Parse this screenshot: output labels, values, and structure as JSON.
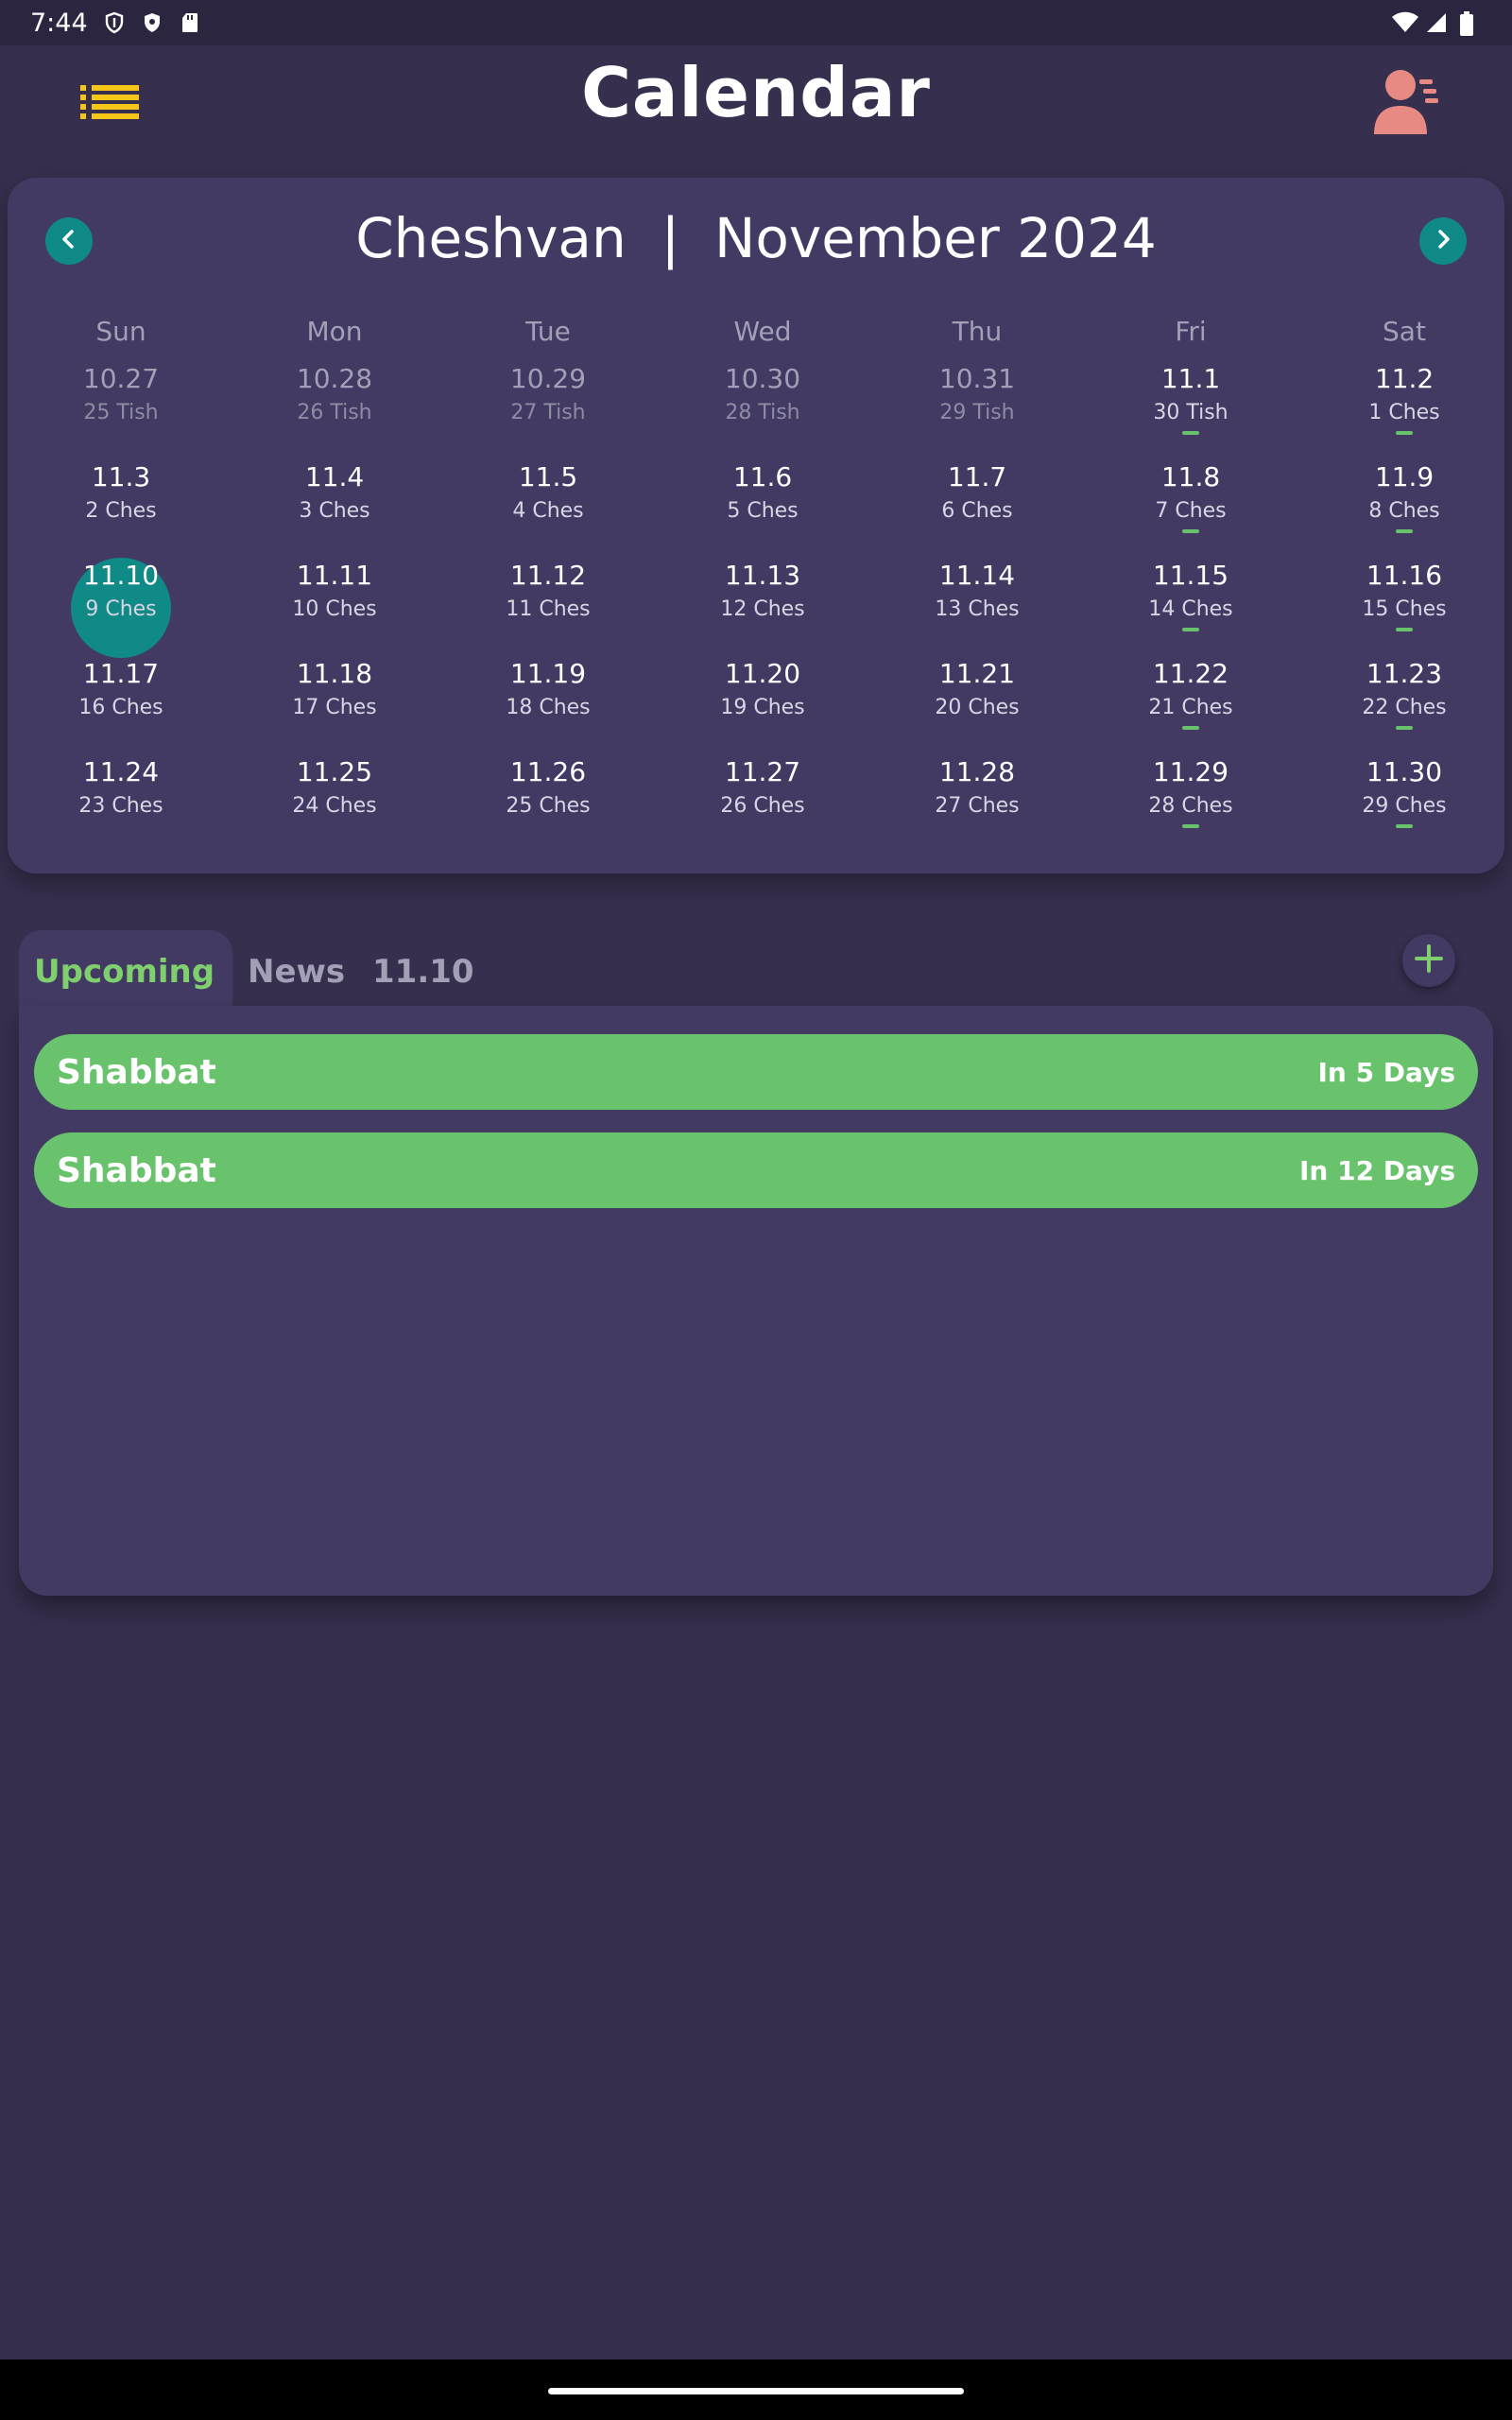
{
  "status_bar": {
    "time": "7:44",
    "left_icons": [
      "shield-icon",
      "shield-dot-icon",
      "sd-card-icon"
    ],
    "right_icons": [
      "wifi-icon",
      "signal-icon",
      "battery-icon"
    ]
  },
  "header": {
    "title": "Calendar",
    "menu_icon": "list-icon",
    "profile_icon": "user-profile-icon",
    "colors": {
      "menu": "#f5c518",
      "profile": "#e88a84"
    }
  },
  "calendar": {
    "title": "Cheshvan  |  November 2024",
    "prev_icon": "chevron-left-icon",
    "next_icon": "chevron-right-icon",
    "weekdays": [
      "Sun",
      "Mon",
      "Tue",
      "Wed",
      "Thu",
      "Fri",
      "Sat"
    ],
    "weeks": [
      [
        {
          "greg": "10.27",
          "heb": "25 Tish",
          "muted": true,
          "event": false,
          "selected": false
        },
        {
          "greg": "10.28",
          "heb": "26 Tish",
          "muted": true,
          "event": false,
          "selected": false
        },
        {
          "greg": "10.29",
          "heb": "27 Tish",
          "muted": true,
          "event": false,
          "selected": false
        },
        {
          "greg": "10.30",
          "heb": "28 Tish",
          "muted": true,
          "event": false,
          "selected": false
        },
        {
          "greg": "10.31",
          "heb": "29 Tish",
          "muted": true,
          "event": false,
          "selected": false
        },
        {
          "greg": "11.1",
          "heb": "30 Tish",
          "muted": false,
          "event": true,
          "selected": false
        },
        {
          "greg": "11.2",
          "heb": "1 Ches",
          "muted": false,
          "event": true,
          "selected": false
        }
      ],
      [
        {
          "greg": "11.3",
          "heb": "2 Ches",
          "muted": false,
          "event": false,
          "selected": false
        },
        {
          "greg": "11.4",
          "heb": "3 Ches",
          "muted": false,
          "event": false,
          "selected": false
        },
        {
          "greg": "11.5",
          "heb": "4 Ches",
          "muted": false,
          "event": false,
          "selected": false
        },
        {
          "greg": "11.6",
          "heb": "5 Ches",
          "muted": false,
          "event": false,
          "selected": false
        },
        {
          "greg": "11.7",
          "heb": "6 Ches",
          "muted": false,
          "event": false,
          "selected": false
        },
        {
          "greg": "11.8",
          "heb": "7 Ches",
          "muted": false,
          "event": true,
          "selected": false
        },
        {
          "greg": "11.9",
          "heb": "8 Ches",
          "muted": false,
          "event": true,
          "selected": false
        }
      ],
      [
        {
          "greg": "11.10",
          "heb": "9 Ches",
          "muted": false,
          "event": false,
          "selected": true
        },
        {
          "greg": "11.11",
          "heb": "10 Ches",
          "muted": false,
          "event": false,
          "selected": false
        },
        {
          "greg": "11.12",
          "heb": "11 Ches",
          "muted": false,
          "event": false,
          "selected": false
        },
        {
          "greg": "11.13",
          "heb": "12 Ches",
          "muted": false,
          "event": false,
          "selected": false
        },
        {
          "greg": "11.14",
          "heb": "13 Ches",
          "muted": false,
          "event": false,
          "selected": false
        },
        {
          "greg": "11.15",
          "heb": "14 Ches",
          "muted": false,
          "event": true,
          "selected": false
        },
        {
          "greg": "11.16",
          "heb": "15 Ches",
          "muted": false,
          "event": true,
          "selected": false
        }
      ],
      [
        {
          "greg": "11.17",
          "heb": "16 Ches",
          "muted": false,
          "event": false,
          "selected": false
        },
        {
          "greg": "11.18",
          "heb": "17 Ches",
          "muted": false,
          "event": false,
          "selected": false
        },
        {
          "greg": "11.19",
          "heb": "18 Ches",
          "muted": false,
          "event": false,
          "selected": false
        },
        {
          "greg": "11.20",
          "heb": "19 Ches",
          "muted": false,
          "event": false,
          "selected": false
        },
        {
          "greg": "11.21",
          "heb": "20 Ches",
          "muted": false,
          "event": false,
          "selected": false
        },
        {
          "greg": "11.22",
          "heb": "21 Ches",
          "muted": false,
          "event": true,
          "selected": false
        },
        {
          "greg": "11.23",
          "heb": "22 Ches",
          "muted": false,
          "event": true,
          "selected": false
        }
      ],
      [
        {
          "greg": "11.24",
          "heb": "23 Ches",
          "muted": false,
          "event": false,
          "selected": false
        },
        {
          "greg": "11.25",
          "heb": "24 Ches",
          "muted": false,
          "event": false,
          "selected": false
        },
        {
          "greg": "11.26",
          "heb": "25 Ches",
          "muted": false,
          "event": false,
          "selected": false
        },
        {
          "greg": "11.27",
          "heb": "26 Ches",
          "muted": false,
          "event": false,
          "selected": false
        },
        {
          "greg": "11.28",
          "heb": "27 Ches",
          "muted": false,
          "event": false,
          "selected": false
        },
        {
          "greg": "11.29",
          "heb": "28 Ches",
          "muted": false,
          "event": true,
          "selected": false
        },
        {
          "greg": "11.30",
          "heb": "29 Ches",
          "muted": false,
          "event": true,
          "selected": false
        }
      ]
    ],
    "colors": {
      "selected": "#0f8a86",
      "event_marker": "#68c36c"
    }
  },
  "tabs": {
    "items": [
      {
        "label": "Upcoming",
        "active": true
      },
      {
        "label": "News",
        "active": false
      },
      {
        "label": "11.10",
        "active": false
      }
    ],
    "add_icon": "plus-icon"
  },
  "events": [
    {
      "name": "Shabbat",
      "when": "In 5 Days"
    },
    {
      "name": "Shabbat",
      "when": "In 12 Days"
    }
  ]
}
